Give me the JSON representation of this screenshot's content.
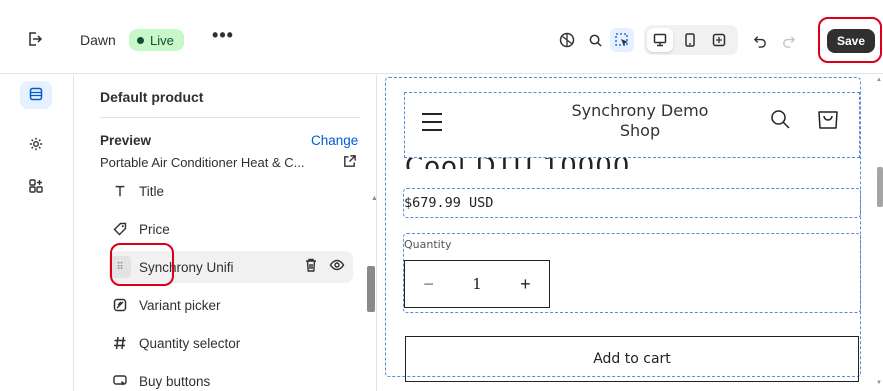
{
  "topbar": {
    "exit_icon": "exit-icon",
    "theme_name": "Dawn",
    "status_badge": "Live",
    "more_label": "•••",
    "icons": [
      "accessibility-icon",
      "search-icon",
      "inspector-icon",
      "desktop-icon",
      "mobile-icon",
      "fullscreen-icon",
      "undo-icon",
      "redo-icon"
    ],
    "save_label": "Save"
  },
  "rail": {
    "items": [
      {
        "icon": "sections-icon",
        "active": true
      },
      {
        "icon": "settings-icon",
        "active": false
      },
      {
        "icon": "apps-icon",
        "active": false
      }
    ]
  },
  "panel": {
    "title": "Default product",
    "preview_label": "Preview",
    "change_label": "Change",
    "preview_product": "Portable Air Conditioner Heat & C...",
    "blocks": [
      {
        "label": "Title",
        "icon": "title-icon"
      },
      {
        "label": "Price",
        "icon": "price-icon"
      },
      {
        "label": "Synchrony Unifi",
        "icon": "drag-handle-icon",
        "selected": true
      },
      {
        "label": "Variant picker",
        "icon": "variant-picker-icon"
      },
      {
        "label": "Quantity selector",
        "icon": "quantity-selector-icon"
      },
      {
        "label": "Buy buttons",
        "icon": "buy-buttons-icon"
      }
    ]
  },
  "store_preview": {
    "shop_name": "Synchrony Demo Shop",
    "product_title_fragment": "Cool DTU 10000",
    "price": "$679.99 USD",
    "quantity_label": "Quantity",
    "quantity_minus": "−",
    "quantity_value": "1",
    "quantity_plus": "+",
    "add_to_cart": "Add to cart"
  },
  "colors": {
    "accent": "#005bd3",
    "highlight_ring": "#d9001b",
    "live_badge_bg": "#c8f7c8",
    "save_bg": "#303030"
  }
}
